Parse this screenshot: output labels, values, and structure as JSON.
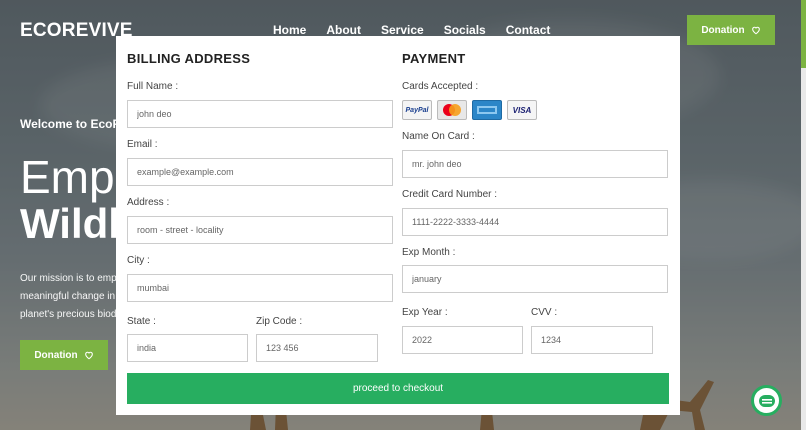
{
  "nav": {
    "logo": "ECOREVIVE",
    "links": [
      "Home",
      "About",
      "Service",
      "Socials",
      "Contact"
    ],
    "donate_label": "Donation"
  },
  "hero": {
    "welcome": "Welcome to EcoR",
    "title_line1": "Empo",
    "title_line2": "Wildl",
    "description": "Our mission is to empo meaningful change in t planet's precious biodi",
    "donate_label": "Donation"
  },
  "billing": {
    "title": "BILLING ADDRESS",
    "full_name": {
      "label": "Full Name :",
      "placeholder": "john deo"
    },
    "email": {
      "label": "Email :",
      "placeholder": "example@example.com"
    },
    "address": {
      "label": "Address :",
      "placeholder": "room - street - locality"
    },
    "city": {
      "label": "City :",
      "placeholder": "mumbai"
    },
    "state": {
      "label": "State :",
      "placeholder": "india"
    },
    "zip": {
      "label": "Zip Code :",
      "placeholder": "123 456"
    }
  },
  "payment": {
    "title": "PAYMENT",
    "cards_label": "Cards Accepted :",
    "cards": [
      "PayPal",
      "MasterCard",
      "American Express",
      "VISA"
    ],
    "name_on_card": {
      "label": "Name On Card :",
      "placeholder": "mr. john deo"
    },
    "card_number": {
      "label": "Credit Card Number :",
      "placeholder": "1111-2222-3333-4444"
    },
    "exp_month": {
      "label": "Exp Month :",
      "placeholder": "january"
    },
    "exp_year": {
      "label": "Exp Year :",
      "placeholder": "2022"
    },
    "cvv": {
      "label": "CVV :",
      "placeholder": "1234"
    }
  },
  "checkout_label": "proceed to checkout",
  "colors": {
    "accent_green": "#7cb342",
    "checkout_green": "#27ae60"
  }
}
